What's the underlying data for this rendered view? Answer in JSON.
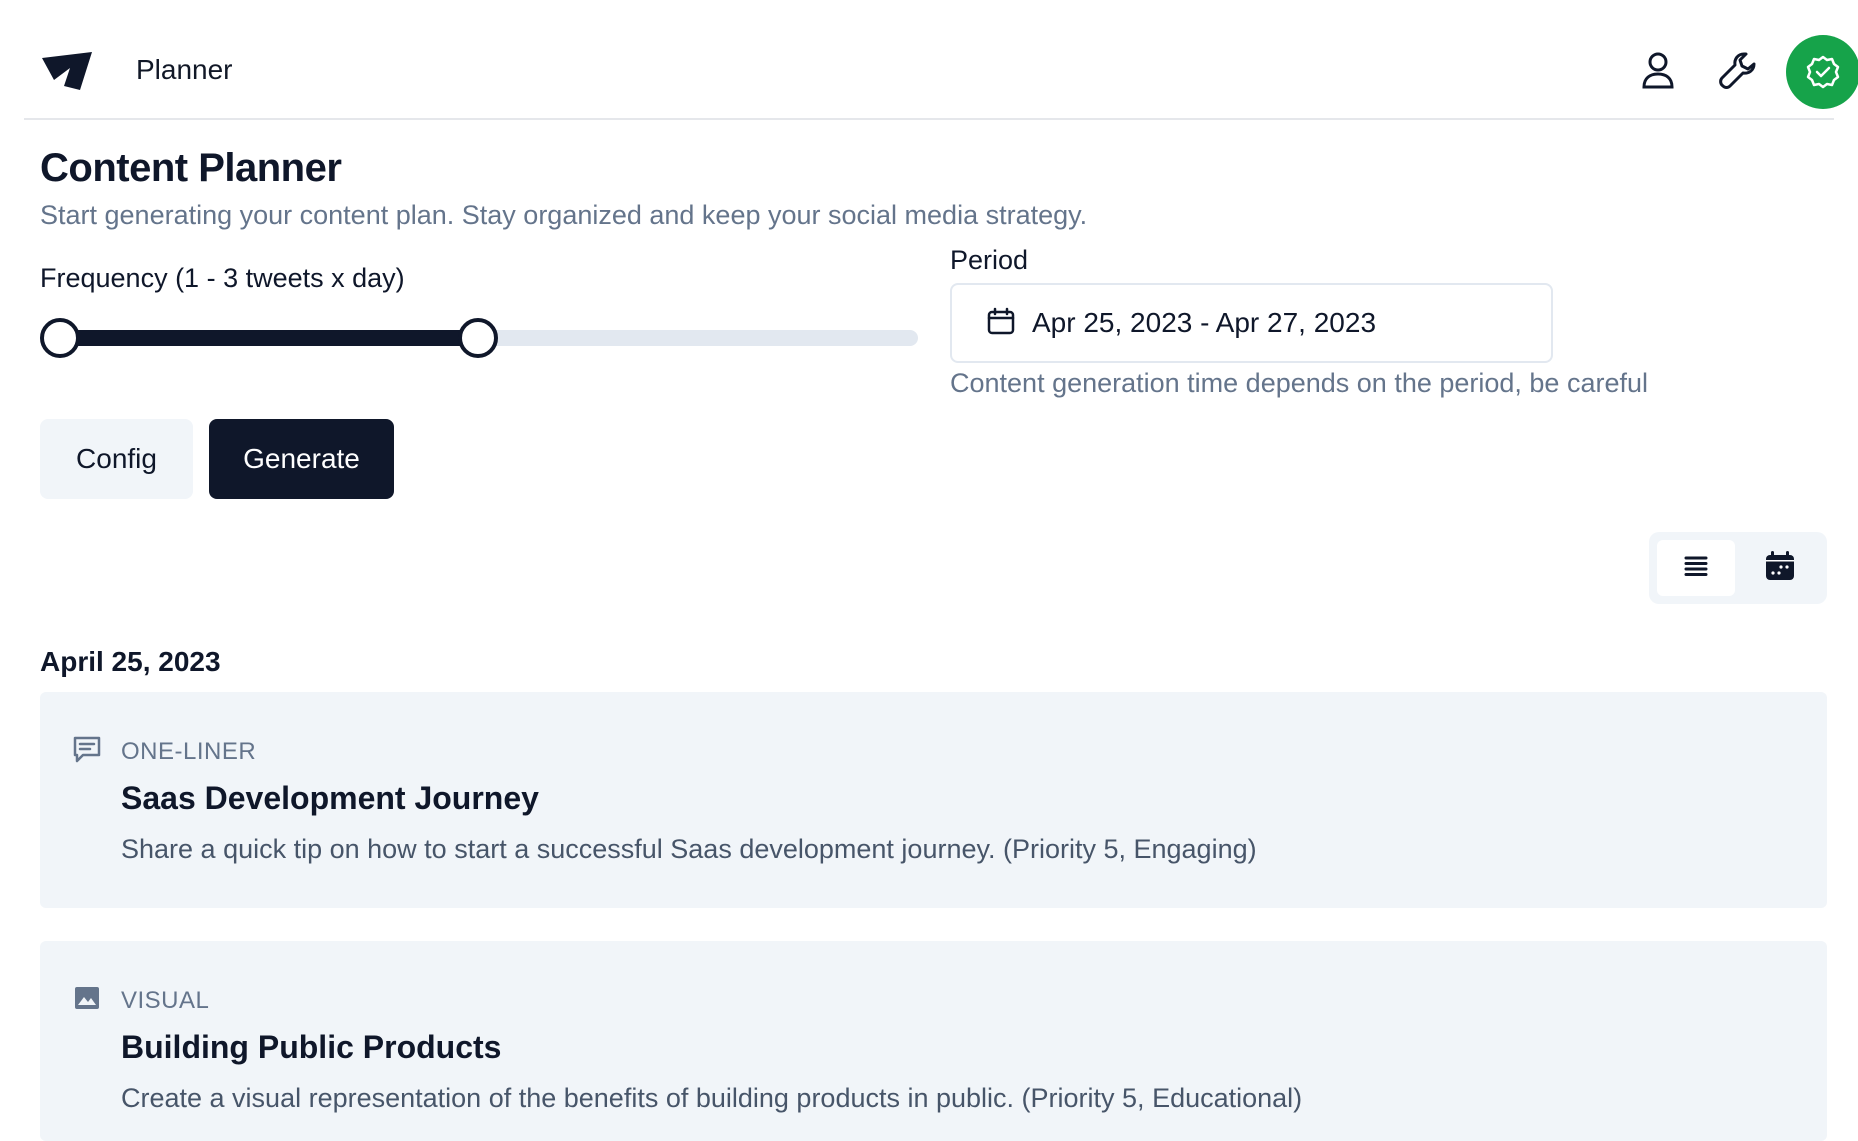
{
  "header": {
    "app_name": "Planner",
    "icons": [
      "logo-icon",
      "user-icon",
      "wrench-icon",
      "check-badge-icon"
    ],
    "status_color": "#16a34a"
  },
  "page": {
    "title": "Content Planner",
    "subtitle": "Start generating your content plan. Stay organized and keep your social media strategy."
  },
  "frequency": {
    "label": "Frequency (1 - 3 tweets x day)",
    "range_start_fraction": 0,
    "range_end_fraction": 0.5
  },
  "period": {
    "label": "Period",
    "value": "Apr 25, 2023 - Apr 27, 2023",
    "hint": "Content generation time depends on the period, be careful"
  },
  "actions": {
    "config_label": "Config",
    "generate_label": "Generate"
  },
  "view_toggle": {
    "active": "list",
    "options": [
      "list-icon",
      "calendar-icon"
    ]
  },
  "schedule": {
    "day_heading": "April 25, 2023",
    "items": [
      {
        "type": "ONE-LINER",
        "icon": "message-icon",
        "title": "Saas Development Journey",
        "description": "Share a quick tip on how to start a successful Saas development journey. (Priority 5, Engaging)"
      },
      {
        "type": "VISUAL",
        "icon": "image-icon",
        "title": "Building Public Products",
        "description": "Create a visual representation of the benefits of building products in public. (Priority 5, Educational)"
      }
    ]
  },
  "colors": {
    "primary": "#0f172a",
    "muted_text": "#64748b",
    "surface": "#f1f5f9"
  }
}
